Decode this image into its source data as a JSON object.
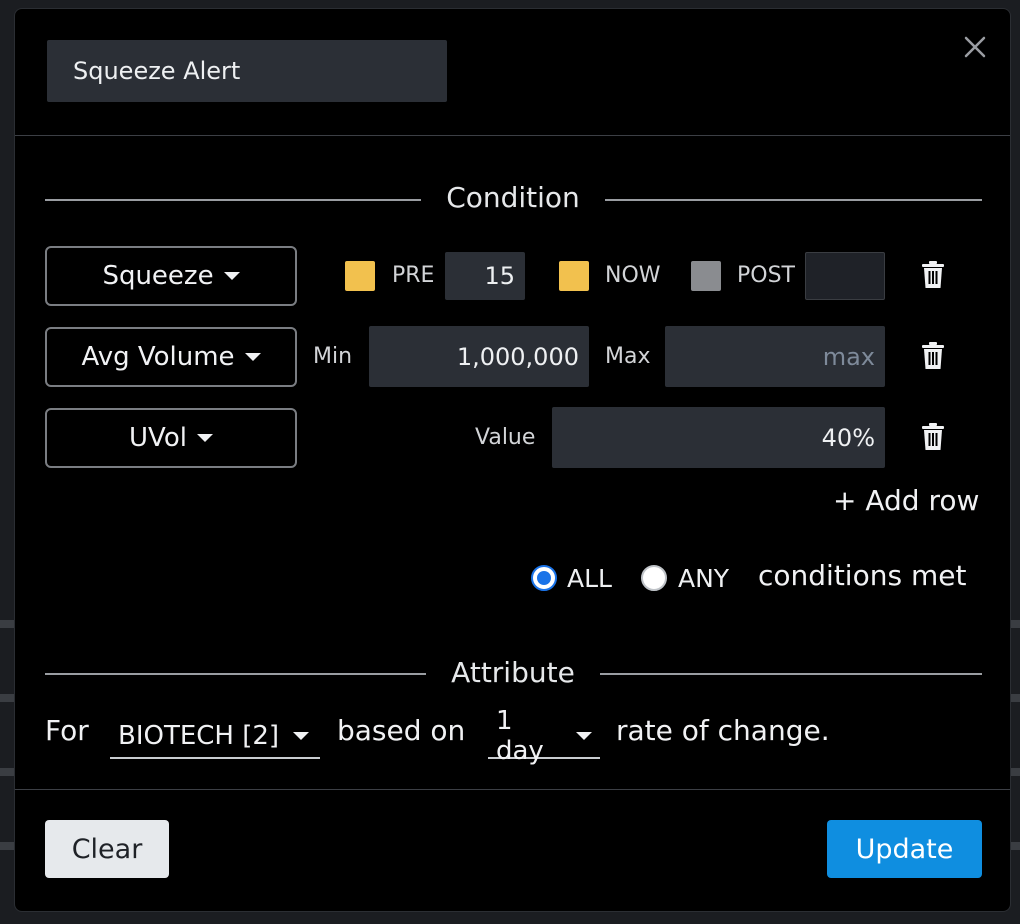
{
  "header": {
    "alert_name": "Squeeze Alert"
  },
  "condition": {
    "title": "Condition",
    "rows": [
      {
        "type": "Squeeze",
        "pre": {
          "label": "PRE",
          "value": "15",
          "color": "#f2c14e"
        },
        "now": {
          "label": "NOW",
          "color": "#f2c14e"
        },
        "post": {
          "label": "POST",
          "value": "",
          "color": "#8a8c90"
        }
      },
      {
        "type": "Avg Volume",
        "min_label": "Min",
        "min_value": "1,000,000",
        "max_label": "Max",
        "max_placeholder": "max",
        "max_value": ""
      },
      {
        "type": "UVol",
        "value_label": "Value",
        "value": "40%"
      }
    ],
    "add_row": "+ Add row",
    "match": {
      "all_label": "ALL",
      "any_label": "ANY",
      "selected": "ALL",
      "suffix": "conditions met"
    }
  },
  "attribute": {
    "title": "Attribute",
    "prefix": "For",
    "group": "BIOTECH [2]",
    "middle": "based on",
    "period": "1 day",
    "suffix": "rate of change."
  },
  "footer": {
    "clear_label": "Clear",
    "update_label": "Update"
  },
  "colors": {
    "accent": "#0f8ee0",
    "swatch_active": "#f2c14e",
    "swatch_inactive": "#8a8c90"
  }
}
